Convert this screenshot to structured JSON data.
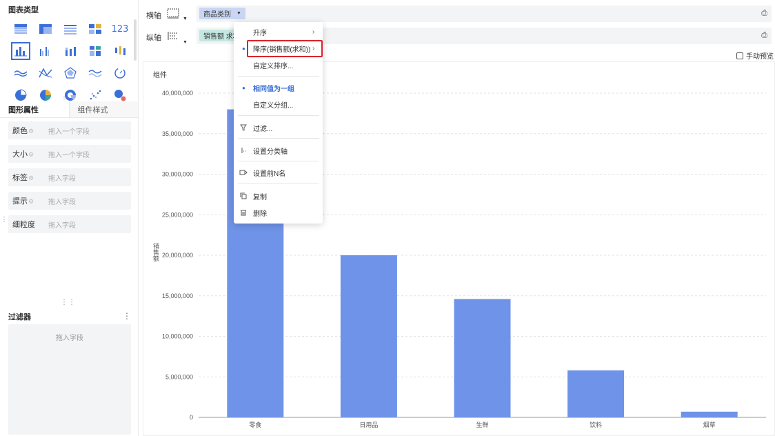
{
  "left_panel": {
    "chart_type_title": "图表类型",
    "chart_types": [
      [
        "table-icon",
        "crosstab-icon",
        "detail-table-icon",
        "block-table-icon",
        "123"
      ],
      [
        "column-chart-icon",
        "grouped-column-icon",
        "stacked-column-icon",
        "percent-column-icon",
        "range-column-icon"
      ],
      [
        "line-chart-icon",
        "multi-line-icon",
        "radar-chart-icon",
        "area-chart-icon",
        "gauge-chart-icon"
      ],
      [
        "pie-chart-icon",
        "donut-chart-icon",
        "rose-chart-icon",
        "scatter-chart-icon",
        "bubble-chart-icon"
      ]
    ],
    "tabs": [
      "图形属性",
      "组件样式"
    ],
    "attributes": [
      {
        "name": "颜色",
        "placeholder": "拖入一个字段"
      },
      {
        "name": "大小",
        "placeholder": "拖入一个字段"
      },
      {
        "name": "标签",
        "placeholder": "拖入字段"
      },
      {
        "name": "提示",
        "placeholder": "拖入字段"
      },
      {
        "name": "细粒度",
        "placeholder": "拖入字段"
      }
    ],
    "filter_title": "过滤器",
    "filter_placeholder": "拖入字段"
  },
  "shelf": {
    "x_label": "横轴",
    "y_label": "纵轴",
    "x_pill": "商品类别",
    "y_pill": "销售额 求和"
  },
  "manual_preview": "手动预览",
  "dropdown": {
    "items": [
      "升序",
      "降序(销售额(求和))",
      "自定义排序...",
      "相同值为一组",
      "自定义分组...",
      "过滤...",
      "设置分类轴",
      "设置前N名",
      "复制",
      "删除"
    ]
  },
  "colors": {
    "bar": "#6f93e8",
    "accent": "#3b6fd8",
    "highlight": "#d9232b"
  },
  "chart_data": {
    "type": "bar",
    "title": "组件",
    "categories": [
      "零食",
      "日用品",
      "生鲜",
      "饮料",
      "烟草"
    ],
    "values": [
      38000000,
      20000000,
      14600000,
      5800000,
      700000
    ],
    "ylabel": "销售额",
    "yticks": [
      "0",
      "5,000,000",
      "10,000,000",
      "15,000,000",
      "20,000,000",
      "25,000,000",
      "30,000,000",
      "35,000,000",
      "40,000,000"
    ],
    "ylim": [
      0,
      40000000
    ],
    "grid": true
  }
}
